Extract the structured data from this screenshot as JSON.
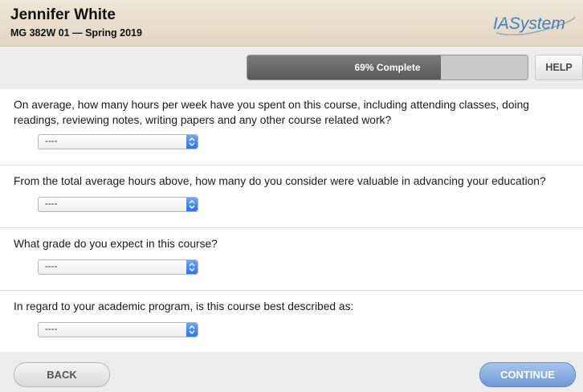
{
  "header": {
    "student_name": "Jennifer White",
    "course": "MG 382W 01 — Spring 2019",
    "logo_text": "IASystem"
  },
  "progress": {
    "percent": 69,
    "label": "69% Complete"
  },
  "help_label": "HELP",
  "questions": [
    {
      "text": "On average, how many hours per week have you spent on this course, including attending classes, doing readings, reviewing notes, writing papers and any other course related work?",
      "selected": "----"
    },
    {
      "text": "From the total average hours above, how many do you consider were valuable in advancing your education?",
      "selected": "----"
    },
    {
      "text": "What grade do you expect in this course?",
      "selected": "----"
    },
    {
      "text": "In regard to your academic program, is this course best described as:",
      "selected": "----"
    }
  ],
  "footer": {
    "back_label": "BACK",
    "continue_label": "CONTINUE"
  },
  "colors": {
    "header_bg": "#e8dccb",
    "logo_blue": "#3f7fc4",
    "progress_fill": "#6a6a6a",
    "continue_bg": "#8bb0e2"
  }
}
